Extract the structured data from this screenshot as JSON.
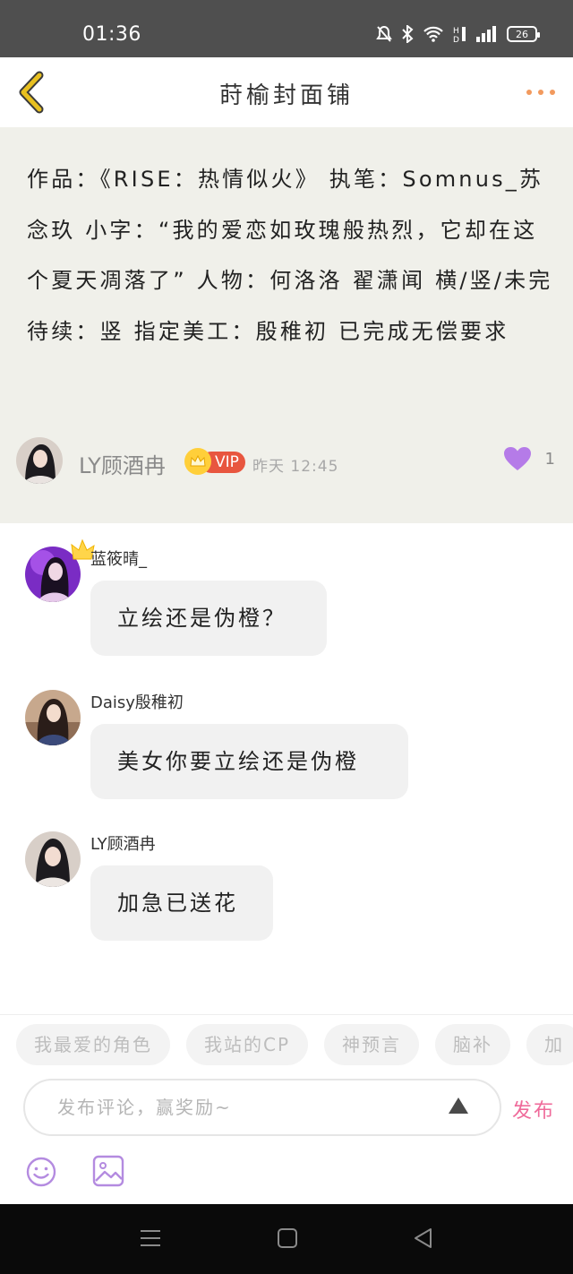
{
  "status_bar": {
    "time": "01:36",
    "battery": "26"
  },
  "nav": {
    "title": "莳榆封面铺"
  },
  "post": {
    "text": "作品：《RISE：热情似火》 执笔：Somnus_苏念玖 小字：“我的爱恋如玫瑰般热烈，它却在这个夏天凋落了” 人物：何洛洛 翟潇闻 横/竖/未完待续：竖 指定美工：殷稚初 已完成无偿要求",
    "author": "LY顾酒冉",
    "vip_label": "VIP",
    "time": "昨天 12:45",
    "like_count": "1"
  },
  "comments": [
    {
      "name": "蓝筱晴_",
      "text": "立绘还是伪橙？"
    },
    {
      "name": "Daisy殷稚初",
      "text": "美女你要立绘还是伪橙"
    },
    {
      "name": "LY顾酒冉",
      "text": "加急已送花"
    }
  ],
  "tags": [
    "我最爱的角色",
    "我站的CP",
    "神预言",
    "脑补",
    "加"
  ],
  "composer": {
    "placeholder": "发布评论，赢奖励~",
    "publish_label": "发布"
  },
  "colors": {
    "accent_like": "#b57be8",
    "publish": "#ef6a9a",
    "vip": "#e8563f",
    "back": "#e8c020",
    "more": "#f29a5e"
  }
}
